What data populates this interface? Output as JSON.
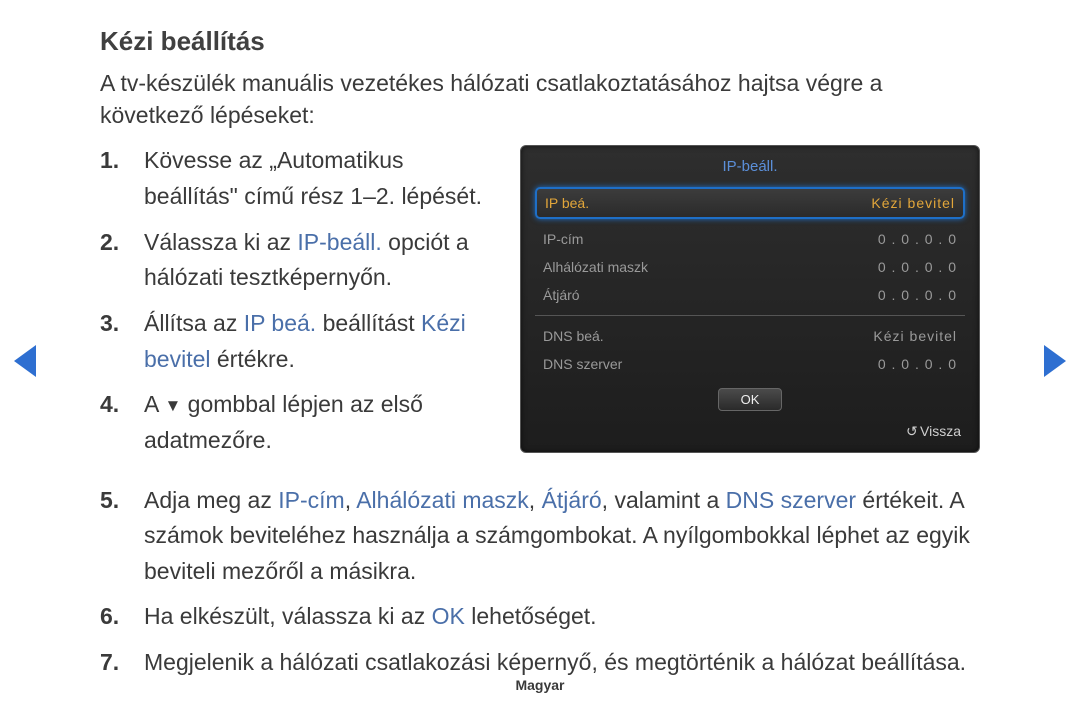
{
  "title": "Kézi beállítás",
  "intro": "A tv-készülék manuális vezetékes hálózati csatlakoztatásához hajtsa végre a következő lépéseket:",
  "steps": {
    "s1": {
      "n": "1.",
      "t1": "Kövesse az „Automatikus beállítás\" című rész 1–2. lépését."
    },
    "s2": {
      "n": "2.",
      "t1": "Válassza ki az ",
      "h1": "IP-beáll.",
      "t2": " opciót a hálózati tesztképernyőn."
    },
    "s3": {
      "n": "3.",
      "t1": "Állítsa az ",
      "h1": "IP beá.",
      "t2": " beállítást ",
      "h2": "Kézi bevitel",
      "t3": " értékre."
    },
    "s4": {
      "n": "4.",
      "t1": "A ",
      "t2": " gombbal lépjen az első adatmezőre."
    },
    "s5": {
      "n": "5.",
      "t1": "Adja meg az ",
      "h1": "IP-cím",
      "c1": ", ",
      "h2": "Alhálózati maszk",
      "c2": ", ",
      "h3": "Átjáró",
      "t2": ", valamint a ",
      "h4": "DNS szerver",
      "t3": " értékeit. A számok beviteléhez használja a számgombokat. A nyílgombokkal léphet az egyik beviteli mezőről a másikra."
    },
    "s6": {
      "n": "6.",
      "t1": "Ha elkészült, válassza ki az ",
      "h1": "OK",
      "t2": " lehetőséget."
    },
    "s7": {
      "n": "7.",
      "t1": "Megjelenik a hálózati csatlakozási képernyő, és megtörténik a hálózat beállítása."
    }
  },
  "panel": {
    "title": "IP-beáll.",
    "rows": {
      "r1": {
        "lab": "IP beá.",
        "val": "Kézi bevitel"
      },
      "r2": {
        "lab": "IP-cím",
        "val": "0 . 0 . 0 . 0"
      },
      "r3": {
        "lab": "Alhálózati maszk",
        "val": "0 . 0 . 0 . 0"
      },
      "r4": {
        "lab": "Átjáró",
        "val": "0 . 0 . 0 . 0"
      },
      "r5": {
        "lab": "DNS beá.",
        "val": "Kézi bevitel"
      },
      "r6": {
        "lab": "DNS szerver",
        "val": "0 . 0 . 0 . 0"
      }
    },
    "ok": "OK",
    "back": "Vissza"
  },
  "footer": "Magyar"
}
